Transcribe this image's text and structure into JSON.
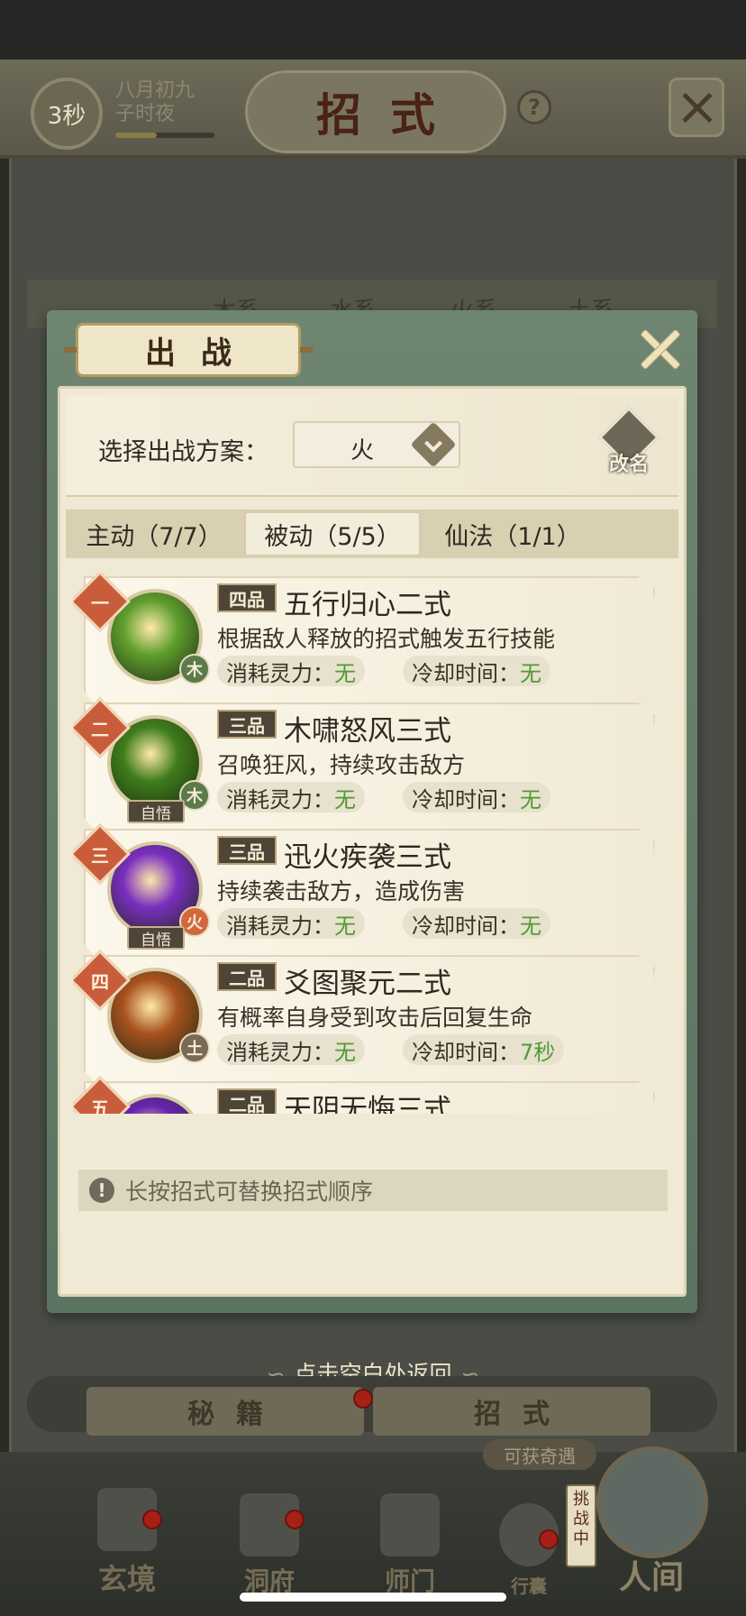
{
  "header": {
    "timer": "3秒",
    "date_line1": "八月初九",
    "date_line2": "子时夜",
    "title": "招式",
    "help": "?"
  },
  "bg_tabs": [
    "木系",
    "水系",
    "火系",
    "土系"
  ],
  "panel": {
    "title": "出战",
    "plan_label": "选择出战方案：",
    "plan_value": "火",
    "rename_label": "改名",
    "tabs": [
      {
        "label": "主动（7/7）",
        "active": false
      },
      {
        "label": "被动（5/5）",
        "active": true
      },
      {
        "label": "仙法（1/1）",
        "active": false
      }
    ],
    "cost_label": "消耗灵力：",
    "cooldown_label": "冷却时间：",
    "skills": [
      {
        "num": "一",
        "grade": "四品",
        "name": "五行归心二式",
        "desc": "根据敌人释放的招式触发五行技能",
        "element": "木",
        "self_learned": "",
        "cost": "无",
        "cooldown": "无",
        "icon_color": "#5f9f2e",
        "element_color": "#5c7a4a"
      },
      {
        "num": "二",
        "grade": "三品",
        "name": "木啸怒风三式",
        "desc": "召唤狂风，持续攻击敌方",
        "element": "木",
        "self_learned": "自悟",
        "cost": "无",
        "cooldown": "无",
        "icon_color": "#3f7d1c",
        "element_color": "#5c7a4a"
      },
      {
        "num": "三",
        "grade": "三品",
        "name": "迅火疾袭三式",
        "desc": "持续袭击敌方，造成伤害",
        "element": "火",
        "self_learned": "自悟",
        "cost": "无",
        "cooldown": "无",
        "icon_color": "#7a2ec0",
        "element_color": "#d2683c"
      },
      {
        "num": "四",
        "grade": "二品",
        "name": "爻图聚元二式",
        "desc": "有概率自身受到攻击后回复生命",
        "element": "土",
        "self_learned": "",
        "cost": "无",
        "cooldown": "7秒",
        "icon_color": "#a8521e",
        "element_color": "#7a6a55"
      },
      {
        "num": "五",
        "grade": "二品",
        "name": "天阴无悔三式",
        "desc": "",
        "element": "",
        "self_learned": "",
        "cost": "",
        "cooldown": "",
        "icon_color": "#6a24b0",
        "element_color": "#5c7a4a"
      }
    ],
    "tip": "长按招式可替换招式顺序"
  },
  "back_hint": "点击空白处返回",
  "bottom_tabs": [
    "秘籍",
    "招式"
  ],
  "chance_badge": "可获奇遇",
  "challenge": "挑战中",
  "dock": [
    "玄境",
    "洞府",
    "师门",
    "行囊",
    "人间"
  ]
}
